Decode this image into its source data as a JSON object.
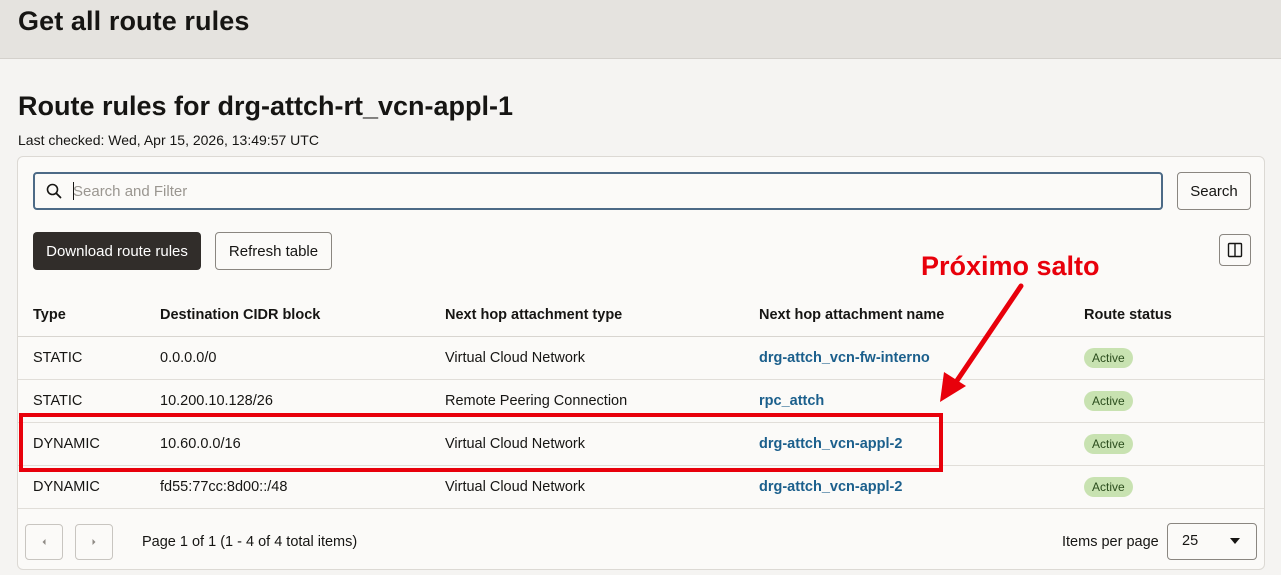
{
  "header": {
    "title": "Get all route rules"
  },
  "section": {
    "title": "Route rules for drg-attch-rt_vcn-appl-1",
    "last_checked": "Last checked: Wed, Apr 15, 2026, 13:49:57 UTC"
  },
  "toolbar": {
    "search_placeholder": "Search and Filter",
    "search_label": "Search",
    "download_label": "Download route rules",
    "refresh_label": "Refresh table"
  },
  "table": {
    "columns": [
      "Type",
      "Destination CIDR block",
      "Next hop attachment type",
      "Next hop attachment name",
      "Route status"
    ],
    "rows": [
      [
        "STATIC",
        "0.0.0.0/0",
        "Virtual Cloud Network",
        "drg-attch_vcn-fw-interno",
        "Active"
      ],
      [
        "STATIC",
        "10.200.10.128/26",
        "Remote Peering Connection",
        "rpc_attch",
        "Active"
      ],
      [
        "DYNAMIC",
        "10.60.0.0/16",
        "Virtual Cloud Network",
        "drg-attch_vcn-appl-2",
        "Active"
      ],
      [
        "DYNAMIC",
        "fd55:77cc:8d00::/48",
        "Virtual Cloud Network",
        "drg-attch_vcn-appl-2",
        "Active"
      ]
    ]
  },
  "pagination": {
    "info": "Page 1 of 1 (1 - 4 of 4 total items)",
    "items_per_page_label": "Items per page",
    "items_per_page_value": "25"
  },
  "annotation": {
    "label": "Próximo salto",
    "color": "#e8000b"
  },
  "icons": {
    "search": "search-icon",
    "columns": "columns-icon",
    "prev": "chevron-left-icon",
    "next": "chevron-right-icon",
    "dropdown": "caret-down-icon"
  },
  "colors": {
    "primary_button": "#312d2a",
    "link": "#1b5f8c",
    "badge": "#c8e2b1",
    "highlight": "#e8000b"
  }
}
